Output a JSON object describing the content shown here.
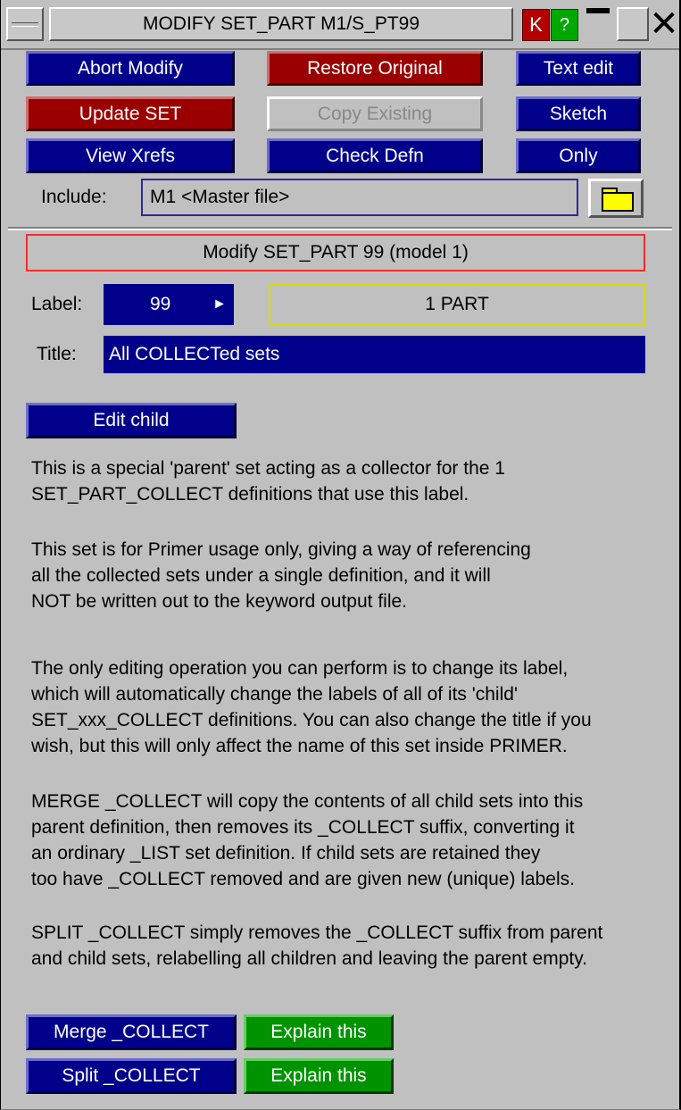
{
  "window": {
    "title": "MODIFY SET_PART M1/S_PT99",
    "k_label": "K",
    "help_label": "?"
  },
  "toolbar": {
    "abort_modify": "Abort Modify",
    "restore_original": "Restore Original",
    "text_edit": "Text edit",
    "update_set": "Update SET",
    "copy_existing": "Copy Existing",
    "sketch": "Sketch",
    "view_xrefs": "View Xrefs",
    "check_defn": "Check Defn",
    "only": "Only"
  },
  "include": {
    "label": "Include:",
    "value": "M1  <Master file>"
  },
  "panel": {
    "heading": "Modify SET_PART 99 (model 1)",
    "label_caption": "Label:",
    "label_value": "99",
    "part_count": "1 PART",
    "title_caption": "Title:",
    "title_value": "All COLLECTed sets",
    "edit_child": "Edit child"
  },
  "description": {
    "p1": [
      "This is a special 'parent' set acting as a collector for the 1",
      "SET_PART_COLLECT definitions that use this label."
    ],
    "p2": [
      "This set is for Primer usage only, giving a way of referencing",
      "all the collected sets under a single definition, and it will",
      "NOT be written out to the keyword output file."
    ],
    "p3": [
      "The only editing operation you can perform is to change its label,",
      "which will automatically change the labels of all of its 'child'",
      "SET_xxx_COLLECT definitions. You can also change the title if you",
      "wish, but this will only affect the name of this set inside PRIMER."
    ],
    "p4": [
      "MERGE _COLLECT will copy the contents of all child sets into this",
      "parent definition, then removes its _COLLECT suffix, converting it",
      "an ordinary _LIST set definition.  If child sets are retained they",
      "too have _COLLECT removed and are given new (unique) labels."
    ],
    "p5": [
      "SPLIT _COLLECT simply removes the _COLLECT suffix from parent",
      "and child sets, relabelling all children and leaving the parent empty."
    ]
  },
  "actions": {
    "merge_collect": "Merge _COLLECT",
    "split_collect": "Split _COLLECT",
    "explain_merge": "Explain this",
    "explain_split": "Explain this"
  }
}
